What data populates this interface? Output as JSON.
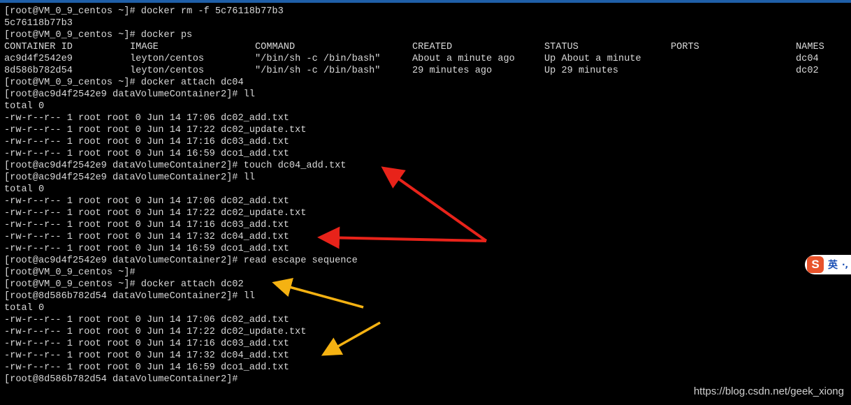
{
  "terminal": {
    "lines_top": [
      "[root@VM_0_9_centos ~]# docker rm -f 5c76118b77b3",
      "5c76118b77b3",
      "[root@VM_0_9_centos ~]# docker ps"
    ],
    "ps_table": {
      "headers": [
        "CONTAINER ID",
        "IMAGE",
        "COMMAND",
        "CREATED",
        "STATUS",
        "PORTS",
        "NAMES"
      ],
      "rows": [
        [
          "ac9d4f2542e9",
          "leyton/centos",
          "\"/bin/sh -c /bin/bash\"",
          "About a minute ago",
          "Up About a minute",
          "",
          "dc04"
        ],
        [
          "8d586b782d54",
          "leyton/centos",
          "\"/bin/sh -c /bin/bash\"",
          "29 minutes ago",
          "Up 29 minutes",
          "",
          "dc02"
        ]
      ]
    },
    "lines_bottom": [
      "[root@VM_0_9_centos ~]# docker attach dc04",
      "[root@ac9d4f2542e9 dataVolumeContainer2]# ll",
      "total 0",
      "-rw-r--r-- 1 root root 0 Jun 14 17:06 dc02_add.txt",
      "-rw-r--r-- 1 root root 0 Jun 14 17:22 dc02_update.txt",
      "-rw-r--r-- 1 root root 0 Jun 14 17:16 dc03_add.txt",
      "-rw-r--r-- 1 root root 0 Jun 14 16:59 dco1_add.txt",
      "[root@ac9d4f2542e9 dataVolumeContainer2]# touch dc04_add.txt",
      "[root@ac9d4f2542e9 dataVolumeContainer2]# ll",
      "total 0",
      "-rw-r--r-- 1 root root 0 Jun 14 17:06 dc02_add.txt",
      "-rw-r--r-- 1 root root 0 Jun 14 17:22 dc02_update.txt",
      "-rw-r--r-- 1 root root 0 Jun 14 17:16 dc03_add.txt",
      "-rw-r--r-- 1 root root 0 Jun 14 17:32 dc04_add.txt",
      "-rw-r--r-- 1 root root 0 Jun 14 16:59 dco1_add.txt",
      "[root@ac9d4f2542e9 dataVolumeContainer2]# read escape sequence",
      "[root@VM_0_9_centos ~]#",
      "[root@VM_0_9_centos ~]# docker attach dc02",
      "[root@8d586b782d54 dataVolumeContainer2]# ll",
      "total 0",
      "-rw-r--r-- 1 root root 0 Jun 14 17:06 dc02_add.txt",
      "-rw-r--r-- 1 root root 0 Jun 14 17:22 dc02_update.txt",
      "-rw-r--r-- 1 root root 0 Jun 14 17:16 dc03_add.txt",
      "-rw-r--r-- 1 root root 0 Jun 14 17:32 dc04_add.txt",
      "-rw-r--r-- 1 root root 0 Jun 14 16:59 dco1_add.txt",
      "[root@8d586b782d54 dataVolumeContainer2]#"
    ]
  },
  "ime": {
    "logo": "S",
    "language": "英",
    "punct": "·,"
  },
  "watermark": "https://blog.csdn.net/geek_xiong",
  "colors": {
    "background": "#000000",
    "text": "#d9d9d9",
    "arrow_red": "#e8231a",
    "arrow_orange": "#f5b212",
    "ime_logo": "#e8532b"
  }
}
